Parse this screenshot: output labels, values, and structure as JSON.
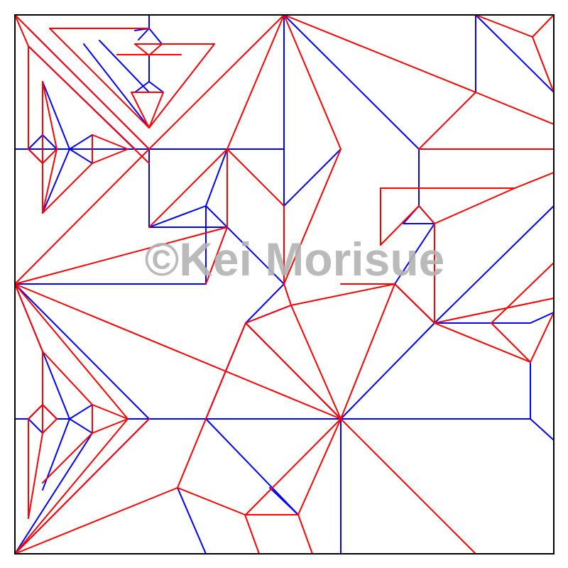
{
  "watermark": "©Kei Morisue",
  "colors": {
    "mountain": "#ff0000",
    "valley": "#0000ff",
    "border": "#000000",
    "watermark": "#b3b3b3",
    "background": "#ffffff"
  },
  "diagram": {
    "type": "origami crease pattern",
    "mountain_color": "red",
    "valley_color": "blue",
    "border_color": "black"
  }
}
